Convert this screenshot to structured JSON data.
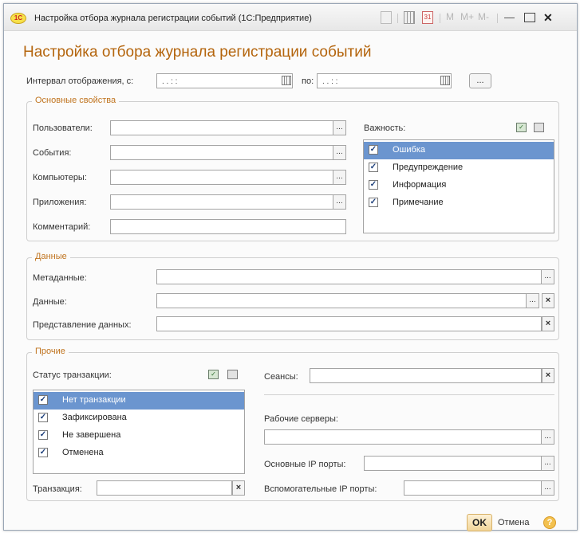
{
  "window": {
    "title": "Настройка отбора журнала регистрации событий  (1С:Предприятие)",
    "logo_text": "1С",
    "toolbar": {
      "m": "M",
      "mplus": "M+",
      "mminus": "M-",
      "calendar_day": "31"
    }
  },
  "heading": "Настройка отбора журнала регистрации событий",
  "interval": {
    "label": "Интервал отображения, с:",
    "from_value": ". .   : :",
    "to_label": "по:",
    "to_value": ". .   : :",
    "more_button": "..."
  },
  "main_group": {
    "title": "Основные свойства",
    "users_label": "Пользователи:",
    "events_label": "События:",
    "computers_label": "Компьютеры:",
    "apps_label": "Приложения:",
    "comment_label": "Комментарий:",
    "select_button": "...",
    "severity_label": "Важность:",
    "severity": [
      {
        "label": "Ошибка",
        "checked": true,
        "selected": true
      },
      {
        "label": "Предупреждение",
        "checked": true,
        "selected": false
      },
      {
        "label": "Информация",
        "checked": true,
        "selected": false
      },
      {
        "label": "Примечание",
        "checked": true,
        "selected": false
      }
    ]
  },
  "data_group": {
    "title": "Данные",
    "metadata_label": "Метаданные:",
    "data_label": "Данные:",
    "presentation_label": "Представление данных:",
    "select_button": "...",
    "clear_button": "×"
  },
  "other_group": {
    "title": "Прочие",
    "tx_status_label": "Статус транзакции:",
    "tx_status": [
      {
        "label": "Нет транзакции",
        "checked": true,
        "selected": true
      },
      {
        "label": "Зафиксирована",
        "checked": true,
        "selected": false
      },
      {
        "label": "Не завершена",
        "checked": true,
        "selected": false
      },
      {
        "label": "Отменена",
        "checked": true,
        "selected": false
      }
    ],
    "transaction_label": "Транзакция:",
    "sessions_label": "Сеансы:",
    "servers_label": "Рабочие серверы:",
    "main_ports_label": "Основные IP порты:",
    "aux_ports_label": "Вспомогательные IP порты:",
    "select_button": "...",
    "clear_button": "×"
  },
  "footer": {
    "ok": "OK",
    "cancel": "Отмена",
    "help": "?"
  }
}
